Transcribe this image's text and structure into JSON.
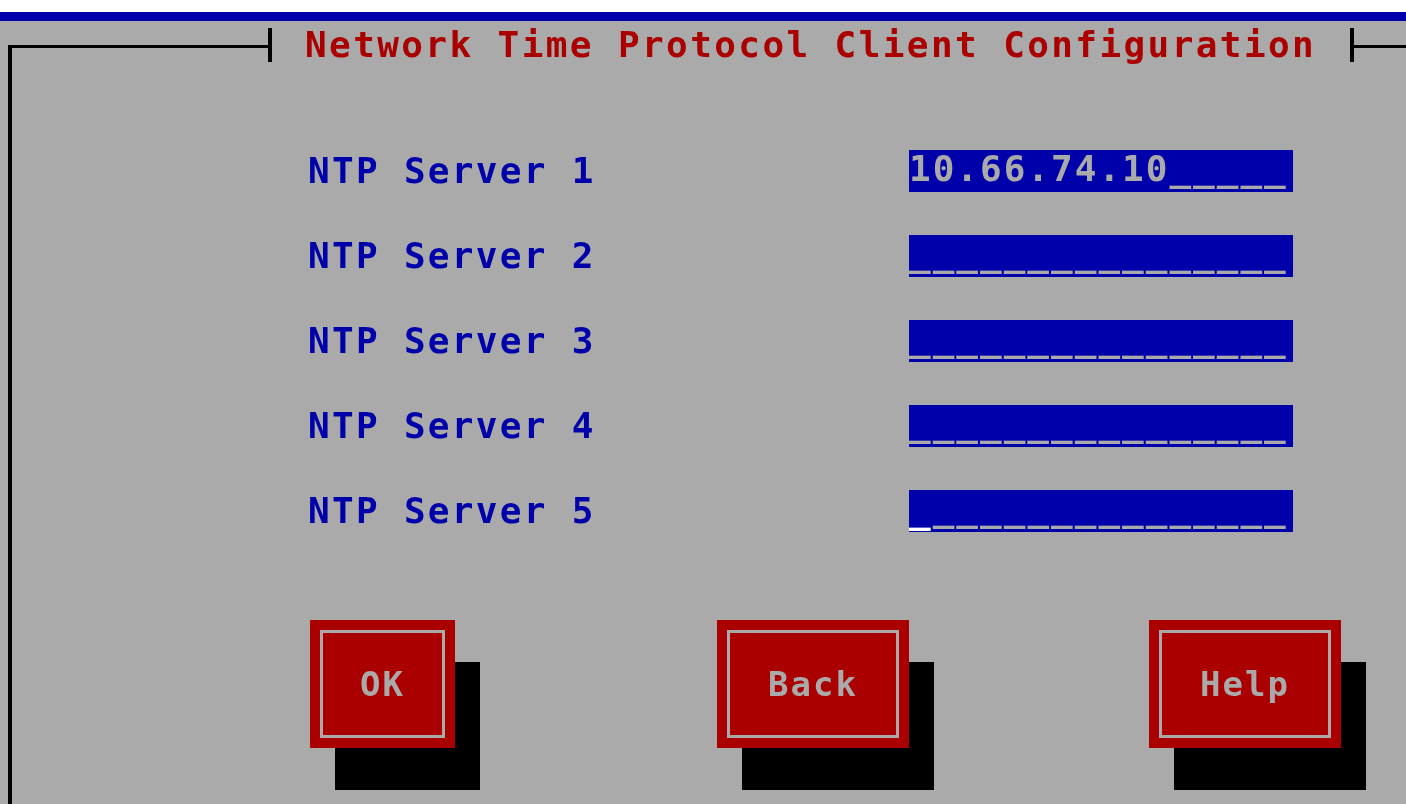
{
  "dialog": {
    "title": "Network Time Protocol Client Configuration"
  },
  "fields": [
    {
      "label": "NTP Server 1",
      "value": "10.66.74.10_____",
      "focused": false
    },
    {
      "label": "NTP Server 2",
      "value": "________________",
      "focused": false
    },
    {
      "label": "NTP Server 3",
      "value": "________________",
      "focused": false
    },
    {
      "label": "NTP Server 4",
      "value": "________________",
      "focused": false
    },
    {
      "label": "NTP Server 5",
      "value": "________________",
      "focused": true
    }
  ],
  "buttons": [
    "OK",
    "Back",
    "Help"
  ]
}
